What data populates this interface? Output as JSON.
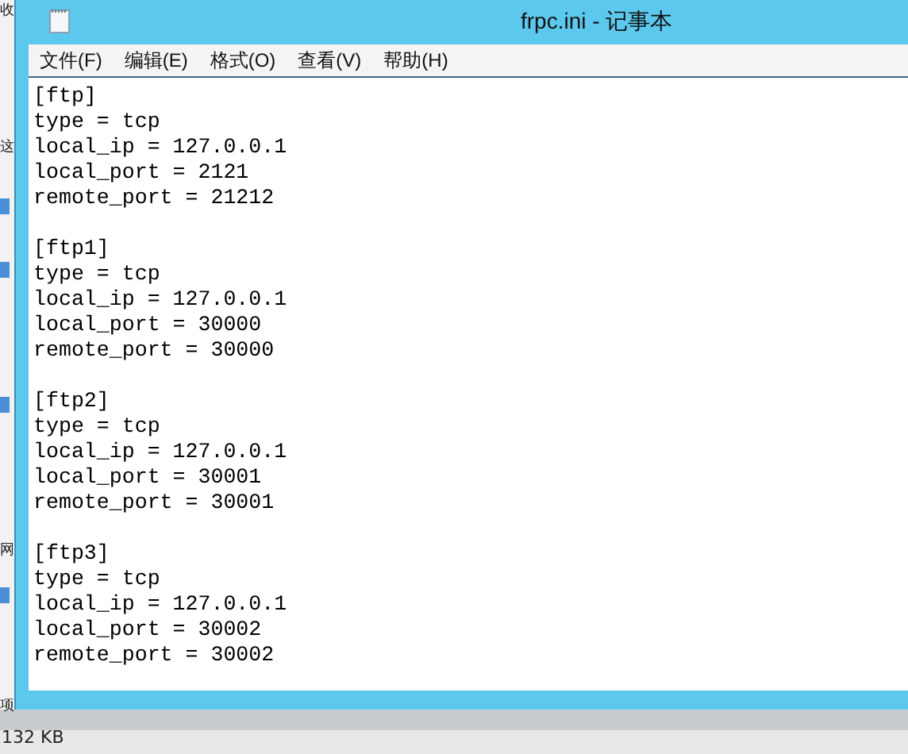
{
  "background": {
    "texts": [
      "收",
      "这",
      "网",
      "项",
      "132 KB"
    ]
  },
  "window": {
    "title": "frpc.ini - 记事本"
  },
  "menu": [
    "文件(F)",
    "编辑(E)",
    "格式(O)",
    "查看(V)",
    "帮助(H)"
  ],
  "editor": {
    "sections": [
      {
        "header": "[ftp]",
        "lines": [
          "type = tcp",
          "local_ip = 127.0.0.1",
          "local_port = 2121",
          "remote_port = 21212"
        ]
      },
      {
        "header": "[ftp1]",
        "lines": [
          "type = tcp",
          "local_ip = 127.0.0.1",
          "local_port = 30000",
          "remote_port = 30000"
        ]
      },
      {
        "header": "[ftp2]",
        "lines": [
          "type = tcp",
          "local_ip = 127.0.0.1",
          "local_port = 30001",
          "remote_port = 30001"
        ]
      },
      {
        "header": "[ftp3]",
        "lines": [
          "type = tcp",
          "local_ip = 127.0.0.1",
          "local_port = 30002",
          "remote_port = 30002"
        ]
      }
    ]
  }
}
